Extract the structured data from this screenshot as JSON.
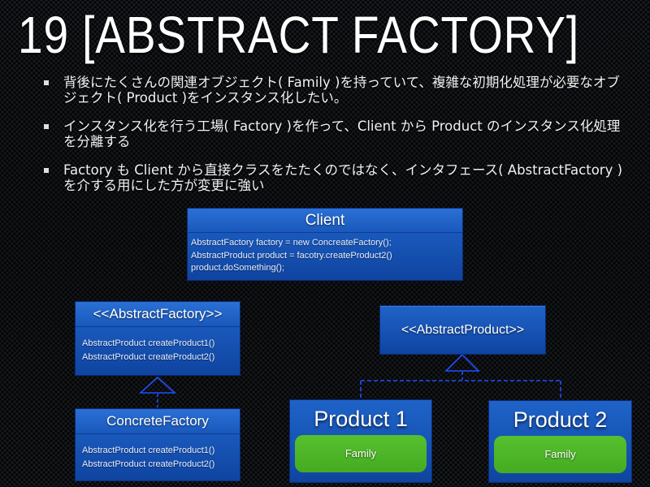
{
  "slide": {
    "title": "19 [ABSTRACT FACTORY]",
    "bullets": [
      "背後にたくさんの関連オブジェクト( Family )を持っていて、複雑な初期化処理が必要なオブジェクト( Product )をインスタンス化したい。",
      "インスタンス化を行う工場( Factory )を作って、Client から Product のインスタンス化処理を分離する",
      "Factory も Client から直接クラスをたたくのではなく、インタフェース( AbstractFactory )を介する用にした方が変更に強い"
    ]
  },
  "diagram": {
    "colors": {
      "box_blue": "#1754b5",
      "connector_blue": "#1f4fff",
      "family_green": "#4bb426"
    },
    "client": {
      "name": "Client",
      "lines": [
        "AbstractFactory factory = new ConcreateFactory();",
        "AbstractProduct product = facotry.createProduct2()",
        "product.doSomething();"
      ]
    },
    "abstract_factory": {
      "name": "<<AbstractFactory>>",
      "methods": [
        "AbstractProduct createProduct1()",
        "AbstractProduct createProduct2()"
      ]
    },
    "concrete_factory": {
      "name": "ConcreteFactory",
      "methods": [
        "AbstractProduct createProduct1()",
        "AbstractProduct createProduct2()"
      ]
    },
    "abstract_product": {
      "name": "<<AbstractProduct>>"
    },
    "products": [
      {
        "name": "Product 1",
        "family": "Family"
      },
      {
        "name": "Product 2",
        "family": "Family"
      }
    ],
    "relations": [
      {
        "from": "ConcreteFactory",
        "to": "<<AbstractFactory>>",
        "type": "realization"
      },
      {
        "from": "Product 1",
        "to": "<<AbstractProduct>>",
        "type": "realization"
      },
      {
        "from": "Product 2",
        "to": "<<AbstractProduct>>",
        "type": "realization"
      }
    ]
  }
}
